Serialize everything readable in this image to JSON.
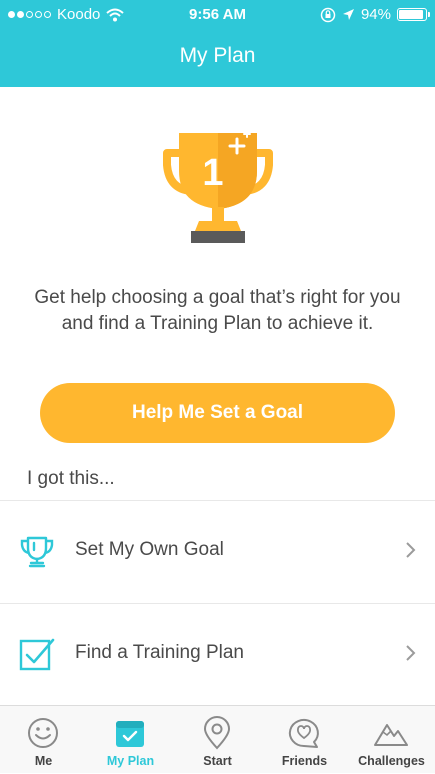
{
  "status_bar": {
    "carrier": "Koodo",
    "time": "9:56 AM",
    "battery": "94%",
    "battery_level": 0.94,
    "signal_bars_filled": 2,
    "signal_bars_total": 5
  },
  "nav": {
    "title": "My Plan"
  },
  "hero": {
    "trophy_number": "1",
    "prompt": "Get help choosing a goal that’s right for you and find a Training Plan to achieve it."
  },
  "cta": {
    "label": "Help Me Set a Goal"
  },
  "section": {
    "label": "I got this..."
  },
  "rows": [
    {
      "label": "Set My Own Goal",
      "icon": "trophy-outline-icon"
    },
    {
      "label": "Find a Training Plan",
      "icon": "checkbox-icon"
    }
  ],
  "tabs": [
    {
      "label": "Me",
      "icon": "smiley-icon",
      "active": false
    },
    {
      "label": "My Plan",
      "icon": "calendar-check-icon",
      "active": true
    },
    {
      "label": "Start",
      "icon": "location-pin-icon",
      "active": false
    },
    {
      "label": "Friends",
      "icon": "heart-chat-icon",
      "active": false
    },
    {
      "label": "Challenges",
      "icon": "mountain-icon",
      "active": false
    }
  ],
  "colors": {
    "accent": "#2ec8d8",
    "cta": "#ffb72f",
    "trophy_gold": "#ffb72f",
    "trophy_base": "#5a5a5a",
    "text": "#4a4a4a"
  }
}
